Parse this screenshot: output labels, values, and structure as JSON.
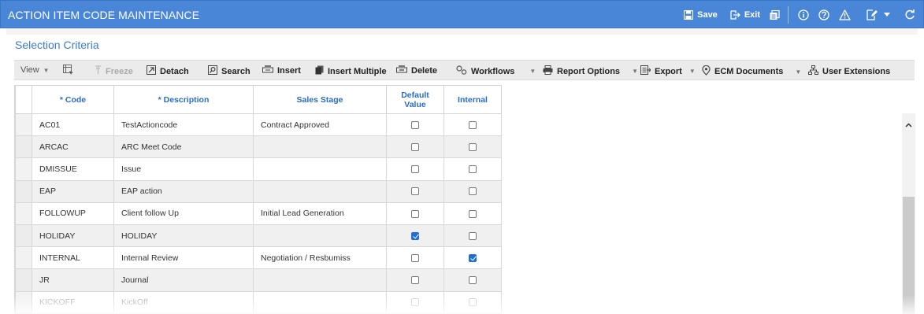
{
  "window": {
    "title": "ACTION ITEM CODE MAINTENANCE",
    "save_label": "Save",
    "exit_label": "Exit"
  },
  "section": {
    "title": "Selection Criteria"
  },
  "toolbar": {
    "view": "View",
    "freeze": "Freeze",
    "detach": "Detach",
    "search": "Search",
    "insert": "Insert",
    "insert_multiple": "Insert Multiple",
    "delete": "Delete",
    "workflows": "Workflows",
    "report_options": "Report Options",
    "export": "Export",
    "ecm_documents": "ECM Documents",
    "user_extensions": "User Extensions"
  },
  "grid": {
    "columns": {
      "code": "* Code",
      "description": "* Description",
      "sales_stage": "Sales Stage",
      "default_value_1": "Default",
      "default_value_2": "Value",
      "internal": "Internal"
    },
    "rows": [
      {
        "code": "AC01",
        "description": "TestActioncode",
        "sales_stage": "Contract Approved",
        "default": false,
        "internal": false
      },
      {
        "code": "ARCAC",
        "description": "ARC Meet Code",
        "sales_stage": "",
        "default": false,
        "internal": false
      },
      {
        "code": "DMISSUE",
        "description": "Issue",
        "sales_stage": "",
        "default": false,
        "internal": false
      },
      {
        "code": "EAP",
        "description": "EAP action",
        "sales_stage": "",
        "default": false,
        "internal": false
      },
      {
        "code": "FOLLOWUP",
        "description": "Client follow Up",
        "sales_stage": "Initial Lead Generation",
        "default": false,
        "internal": false
      },
      {
        "code": "HOLIDAY",
        "description": "HOLIDAY",
        "sales_stage": "",
        "default": true,
        "internal": false
      },
      {
        "code": "INTERNAL",
        "description": "Internal Review",
        "sales_stage": "Negotiation / Resbumiss",
        "default": false,
        "internal": true
      },
      {
        "code": "JR",
        "description": "Journal",
        "sales_stage": "",
        "default": false,
        "internal": false
      },
      {
        "code": "KICKOFF",
        "description": "KickOff",
        "sales_stage": "",
        "default": false,
        "internal": false
      }
    ]
  },
  "icons": {
    "save": "floppy-disk-icon",
    "exit": "exit-icon",
    "copy": "copy-icon",
    "info": "info-icon",
    "help": "help-icon",
    "warning": "warning-icon",
    "edit": "edit-note-icon",
    "refresh": "refresh-icon"
  },
  "colors": {
    "titlebar": "#4a86d8",
    "accent": "#3a7bd5",
    "checked": "#1f6fd6"
  }
}
